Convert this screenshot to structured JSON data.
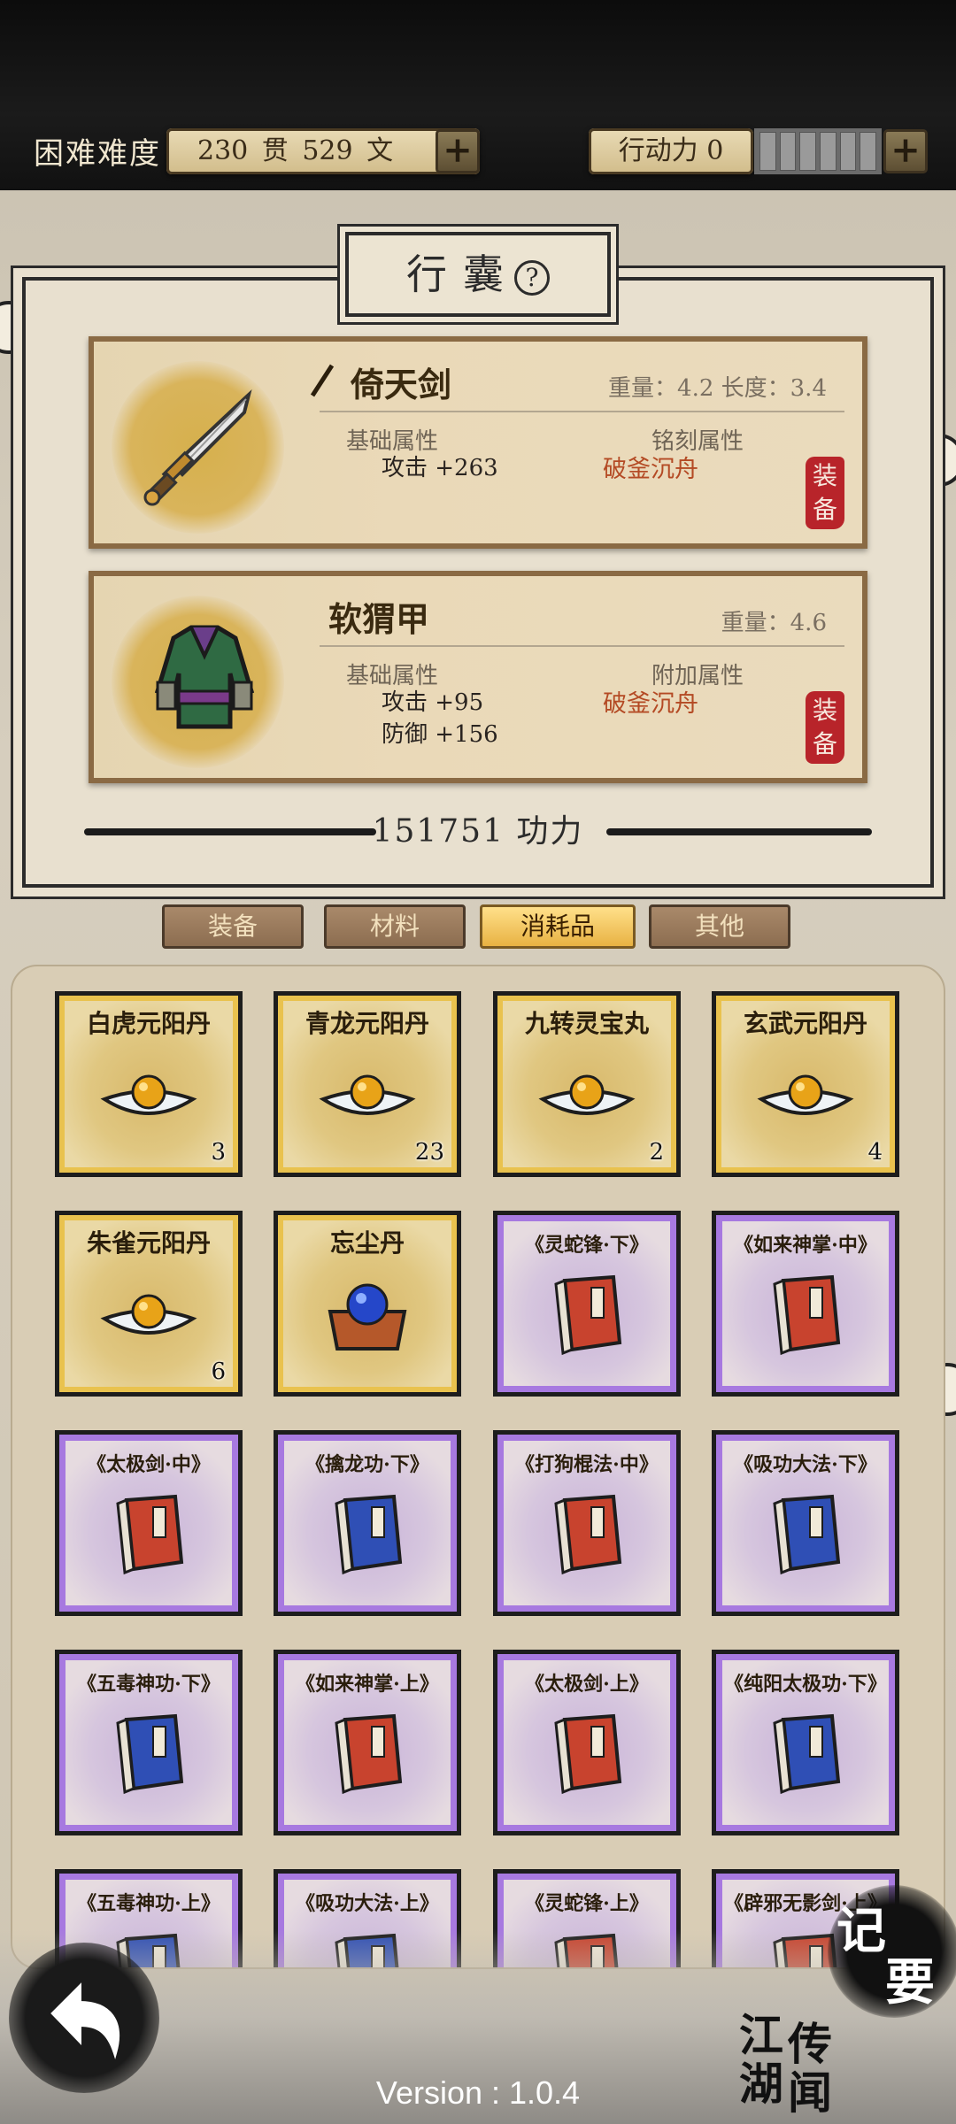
{
  "header": {
    "difficulty": "困难难度",
    "money": "230 贯 529 文",
    "action": "行动力 0",
    "plus": "+",
    "energy_segments": 6
  },
  "bag": {
    "title": "行囊",
    "help": "?",
    "weapon": {
      "name": "倚天剑",
      "meta": "重量：4.2 长度：3.4",
      "base_label": "基础属性",
      "extra_label": "铭刻属性",
      "stats": [
        "攻击 +263"
      ],
      "special": "破釜沉舟",
      "stamp": "装备"
    },
    "armor": {
      "name": "软猬甲",
      "meta": "重量：4.6",
      "base_label": "基础属性",
      "extra_label": "附加属性",
      "stats": [
        "攻击 +95",
        "防御 +156"
      ],
      "special": "破釜沉舟",
      "stamp": "装备"
    },
    "power": "151751 功力"
  },
  "tabs": [
    {
      "label": "装备",
      "active": false
    },
    {
      "label": "材料",
      "active": false
    },
    {
      "label": "消耗品",
      "active": true
    },
    {
      "label": "其他",
      "active": false
    }
  ],
  "items": [
    {
      "name": "白虎元阳丹",
      "count": "3",
      "kind": "pill"
    },
    {
      "name": "青龙元阳丹",
      "count": "23",
      "kind": "pill"
    },
    {
      "name": "九转灵宝丸",
      "count": "2",
      "kind": "pill"
    },
    {
      "name": "玄武元阳丹",
      "count": "4",
      "kind": "pill"
    },
    {
      "name": "朱雀元阳丹",
      "count": "6",
      "kind": "pill"
    },
    {
      "name": "忘尘丹",
      "count": "",
      "kind": "box"
    },
    {
      "name": "《灵蛇锋·下》",
      "count": "",
      "kind": "book-red"
    },
    {
      "name": "《如来神掌·中》",
      "count": "",
      "kind": "book-red"
    },
    {
      "name": "《太极剑·中》",
      "count": "",
      "kind": "book-red"
    },
    {
      "name": "《擒龙功·下》",
      "count": "",
      "kind": "book-blue"
    },
    {
      "name": "《打狗棍法·中》",
      "count": "",
      "kind": "book-red"
    },
    {
      "name": "《吸功大法·下》",
      "count": "",
      "kind": "book-blue"
    },
    {
      "name": "《五毒神功·下》",
      "count": "",
      "kind": "book-blue"
    },
    {
      "name": "《如来神掌·上》",
      "count": "",
      "kind": "book-red"
    },
    {
      "name": "《太极剑·上》",
      "count": "",
      "kind": "book-red"
    },
    {
      "name": "《纯阳太极功·下》",
      "count": "",
      "kind": "book-blue"
    },
    {
      "name": "《五毒神功·上》",
      "count": "",
      "kind": "book-blue"
    },
    {
      "name": "《吸功大法·上》",
      "count": "",
      "kind": "book-blue"
    },
    {
      "name": "《灵蛇锋·上》",
      "count": "",
      "kind": "book-red"
    },
    {
      "name": "《辟邪无影剑·上》",
      "count": "",
      "kind": "book-red"
    }
  ],
  "footer": {
    "jiyao": [
      "记",
      "要"
    ],
    "jianghu": [
      "江",
      "湖",
      "传",
      "闻"
    ],
    "version": "Version : 1.0.4"
  }
}
